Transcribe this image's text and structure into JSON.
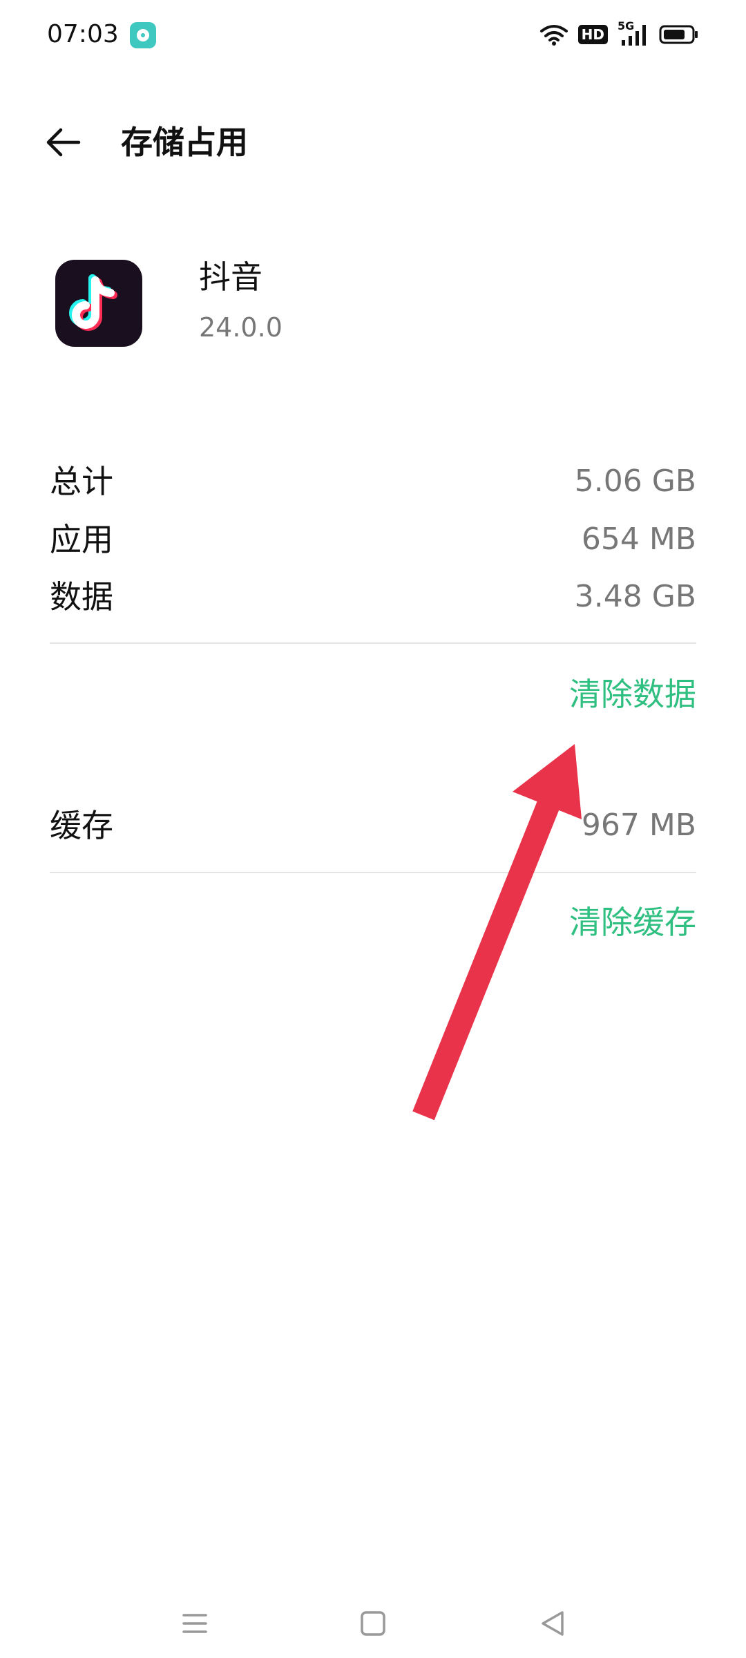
{
  "status_bar": {
    "time": "07:03",
    "hd_label": "HD",
    "network_label": "5G"
  },
  "header": {
    "title": "存储占用"
  },
  "app": {
    "name": "抖音",
    "version": "24.0.0"
  },
  "storage": {
    "rows": [
      {
        "label": "总计",
        "value": "5.06 GB"
      },
      {
        "label": "应用",
        "value": "654 MB"
      },
      {
        "label": "数据",
        "value": "3.48 GB"
      }
    ],
    "clear_data_label": "清除数据",
    "cache": {
      "label": "缓存",
      "value": "967 MB"
    },
    "clear_cache_label": "清除缓存"
  },
  "colors": {
    "accent_green": "#2fbf80",
    "annotation_red": "#e8334a"
  },
  "icons": {
    "back": "arrow-left-icon",
    "wifi": "wifi-icon",
    "signal": "signal-icon",
    "battery": "battery-icon",
    "nav_menu": "menu-icon",
    "nav_home": "square-icon",
    "nav_back": "triangle-back-icon"
  }
}
